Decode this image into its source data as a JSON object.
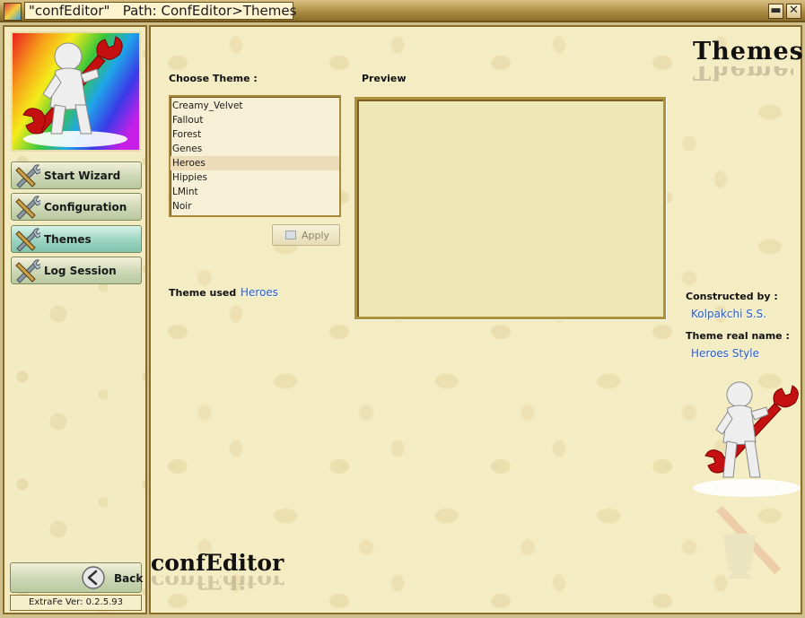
{
  "window": {
    "title": "\"confEditor\"   Path: ConfEditor>Themes",
    "controls": [
      "minimize-icon",
      "close-icon"
    ]
  },
  "sidebar": {
    "nav": [
      {
        "label": "Start Wizard",
        "icon": "tools-icon",
        "active": false
      },
      {
        "label": "Configuration",
        "icon": "tools-icon",
        "active": false
      },
      {
        "label": "Themes",
        "icon": "tools-icon",
        "active": true
      },
      {
        "label": "Log Session",
        "icon": "tools-icon",
        "active": false
      }
    ],
    "back_label": "Back",
    "back_icon": "back-arrow-icon",
    "version": "ExtraFe Ver: 0.2.5.93"
  },
  "main": {
    "heading": "Themes",
    "choose_label": "Choose Theme :",
    "preview_label": "Preview",
    "themes": [
      "Creamy_Velvet",
      "Fallout",
      "Forest",
      "Genes",
      "Heroes",
      "Hippies",
      "LMint",
      "Noir"
    ],
    "selected_theme": "Heroes",
    "apply_label": "Apply",
    "theme_used_label": "Theme used :",
    "theme_used_value": "Heroes",
    "constructed_label": "Constructed by :",
    "constructed_value": "Kolpakchi S.S.",
    "real_name_label": "Theme real name :",
    "real_name_value": "Heroes Style",
    "brand": "confEditor"
  },
  "colors": {
    "frame": "#8a6d2a",
    "background": "#f4ecc2",
    "value_text": "#2e5fb8",
    "active_nav": "#9fd6c4"
  }
}
